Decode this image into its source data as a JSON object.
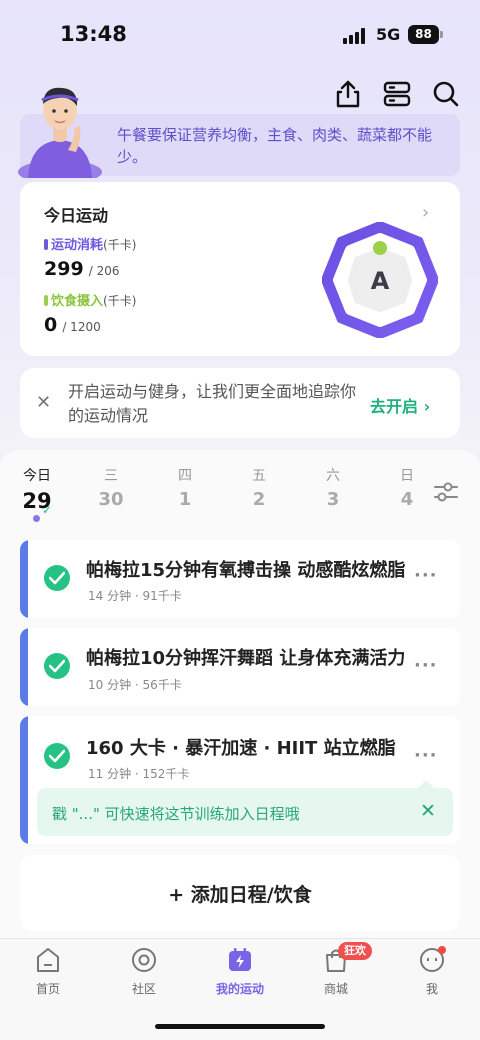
{
  "status_bar": {
    "time": "13:48",
    "network": "5G",
    "battery": "88"
  },
  "header": {
    "icons": [
      "share-icon",
      "storage-icon",
      "search-icon"
    ]
  },
  "banner": {
    "text": "午餐要保证营养均衡，主食、肉类、蔬菜都不能少。"
  },
  "today": {
    "title": "今日运动",
    "burn": {
      "label": "运动消耗",
      "unit": "(千卡)",
      "value": "299",
      "target": "/ 206",
      "color": "#6f57e0"
    },
    "intake": {
      "label": "饮食摄入",
      "unit": "(千卡)",
      "value": "0",
      "target": "/ 1200",
      "color": "#9bd14a"
    },
    "grade": "A"
  },
  "notice": {
    "text": "开启运动与健身，让我们更全面地追踪你的运动情况",
    "action": "去开启 ›"
  },
  "week": [
    {
      "weekday": "今日",
      "date": "29",
      "active": true
    },
    {
      "weekday": "三",
      "date": "30"
    },
    {
      "weekday": "四",
      "date": "1"
    },
    {
      "weekday": "五",
      "date": "2"
    },
    {
      "weekday": "六",
      "date": "3"
    },
    {
      "weekday": "日",
      "date": "4"
    }
  ],
  "workouts": [
    {
      "title": "帕梅拉15分钟有氧搏击操 动感酷炫燃脂",
      "meta": "14 分钟 · 91千卡",
      "done": true
    },
    {
      "title": "帕梅拉10分钟挥汗舞蹈 让身体充满活力",
      "meta": "10 分钟 · 56千卡",
      "done": true
    },
    {
      "title": "160 大卡 · 暴汗加速 · HIIT 站立燃脂",
      "meta": "11 分钟 · 152千卡",
      "done": true
    }
  ],
  "tip": {
    "text": "戳 \"...\" 可快速将这节训练加入日程哦"
  },
  "add": {
    "label": "+ 添加日程/饮食"
  },
  "tabs": [
    {
      "label": "首页"
    },
    {
      "label": "社区"
    },
    {
      "label": "我的运动",
      "active": true
    },
    {
      "label": "商城",
      "badge": "狂欢"
    },
    {
      "label": "我"
    }
  ],
  "colors": {
    "accent": "#7b63e6",
    "success": "#25c283",
    "card_accent": "#5b7be8"
  }
}
